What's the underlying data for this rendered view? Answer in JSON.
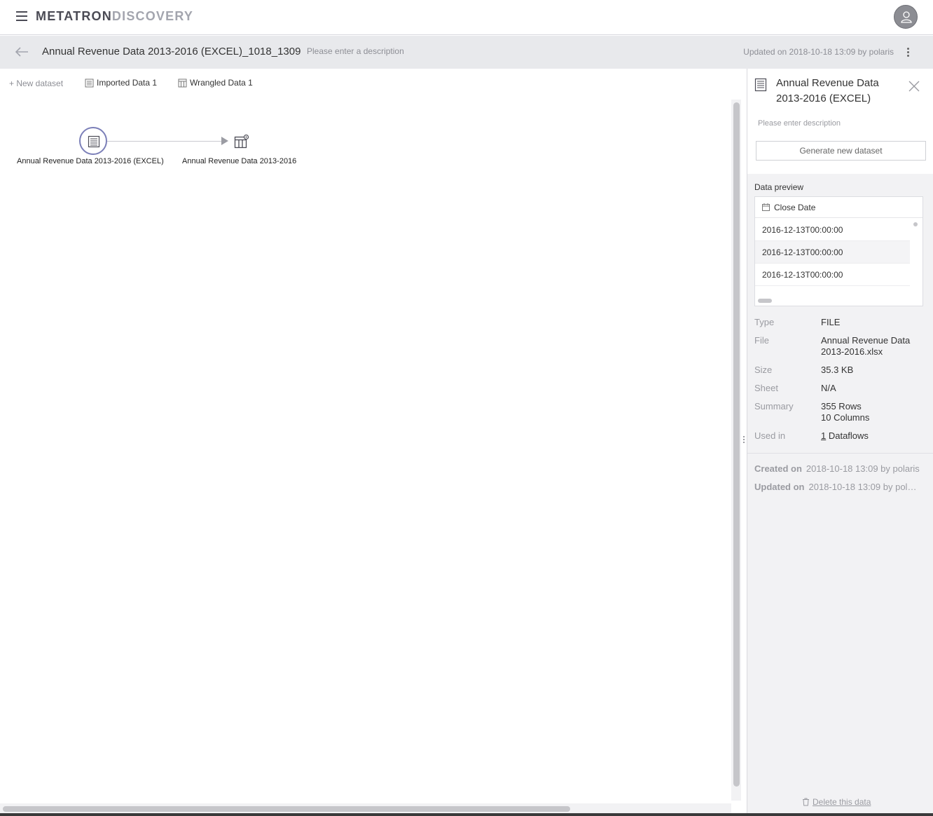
{
  "app": {
    "logo_part1": "METATRON",
    "logo_part2": "DISCOVERY"
  },
  "header": {
    "title": "Annual Revenue Data 2013-2016 (EXCEL)_1018_1309",
    "description_placeholder": "Please enter a description",
    "updated": "Updated on 2018-10-18 13:09 by polaris"
  },
  "toolbar": {
    "new_dataset": "+ New dataset",
    "imported": "Imported Data 1",
    "wrangled": "Wrangled Data 1"
  },
  "graph": {
    "source_node_label": "Annual Revenue Data 2013-2016 (EXCEL)",
    "wrangled_node_label": "Annual Revenue Data 2013-2016"
  },
  "panel": {
    "title": "Annual Revenue Data 2013-2016 (EXCEL)",
    "description_placeholder": "Please enter description",
    "generate_button": "Generate new dataset",
    "preview_label": "Data preview",
    "preview_column": "Close Date",
    "preview_rows": [
      "2016-12-13T00:00:00",
      "2016-12-13T00:00:00",
      "2016-12-13T00:00:00"
    ],
    "meta": {
      "type_label": "Type",
      "type_value": "FILE",
      "file_label": "File",
      "file_value": "Annual Revenue Data 2013-2016.xlsx",
      "size_label": "Size",
      "size_value": "35.3 KB",
      "sheet_label": "Sheet",
      "sheet_value": "N/A",
      "summary_label": "Summary",
      "summary_rows": "355 Rows",
      "summary_cols": "10 Columns",
      "used_label": "Used in",
      "used_count": "1",
      "used_suffix": " Dataflows"
    },
    "created_label": "Created on",
    "created_value": "2018-10-18 13:09 by polaris",
    "updated_label": "Updated on",
    "updated_value": "2018-10-18 13:09 by pol…",
    "delete_label": "Delete this data"
  },
  "colors": {
    "accent_node": "#7b7fb8",
    "header_bg": "#e8e9ec",
    "panel_bg": "#f2f2f4"
  }
}
